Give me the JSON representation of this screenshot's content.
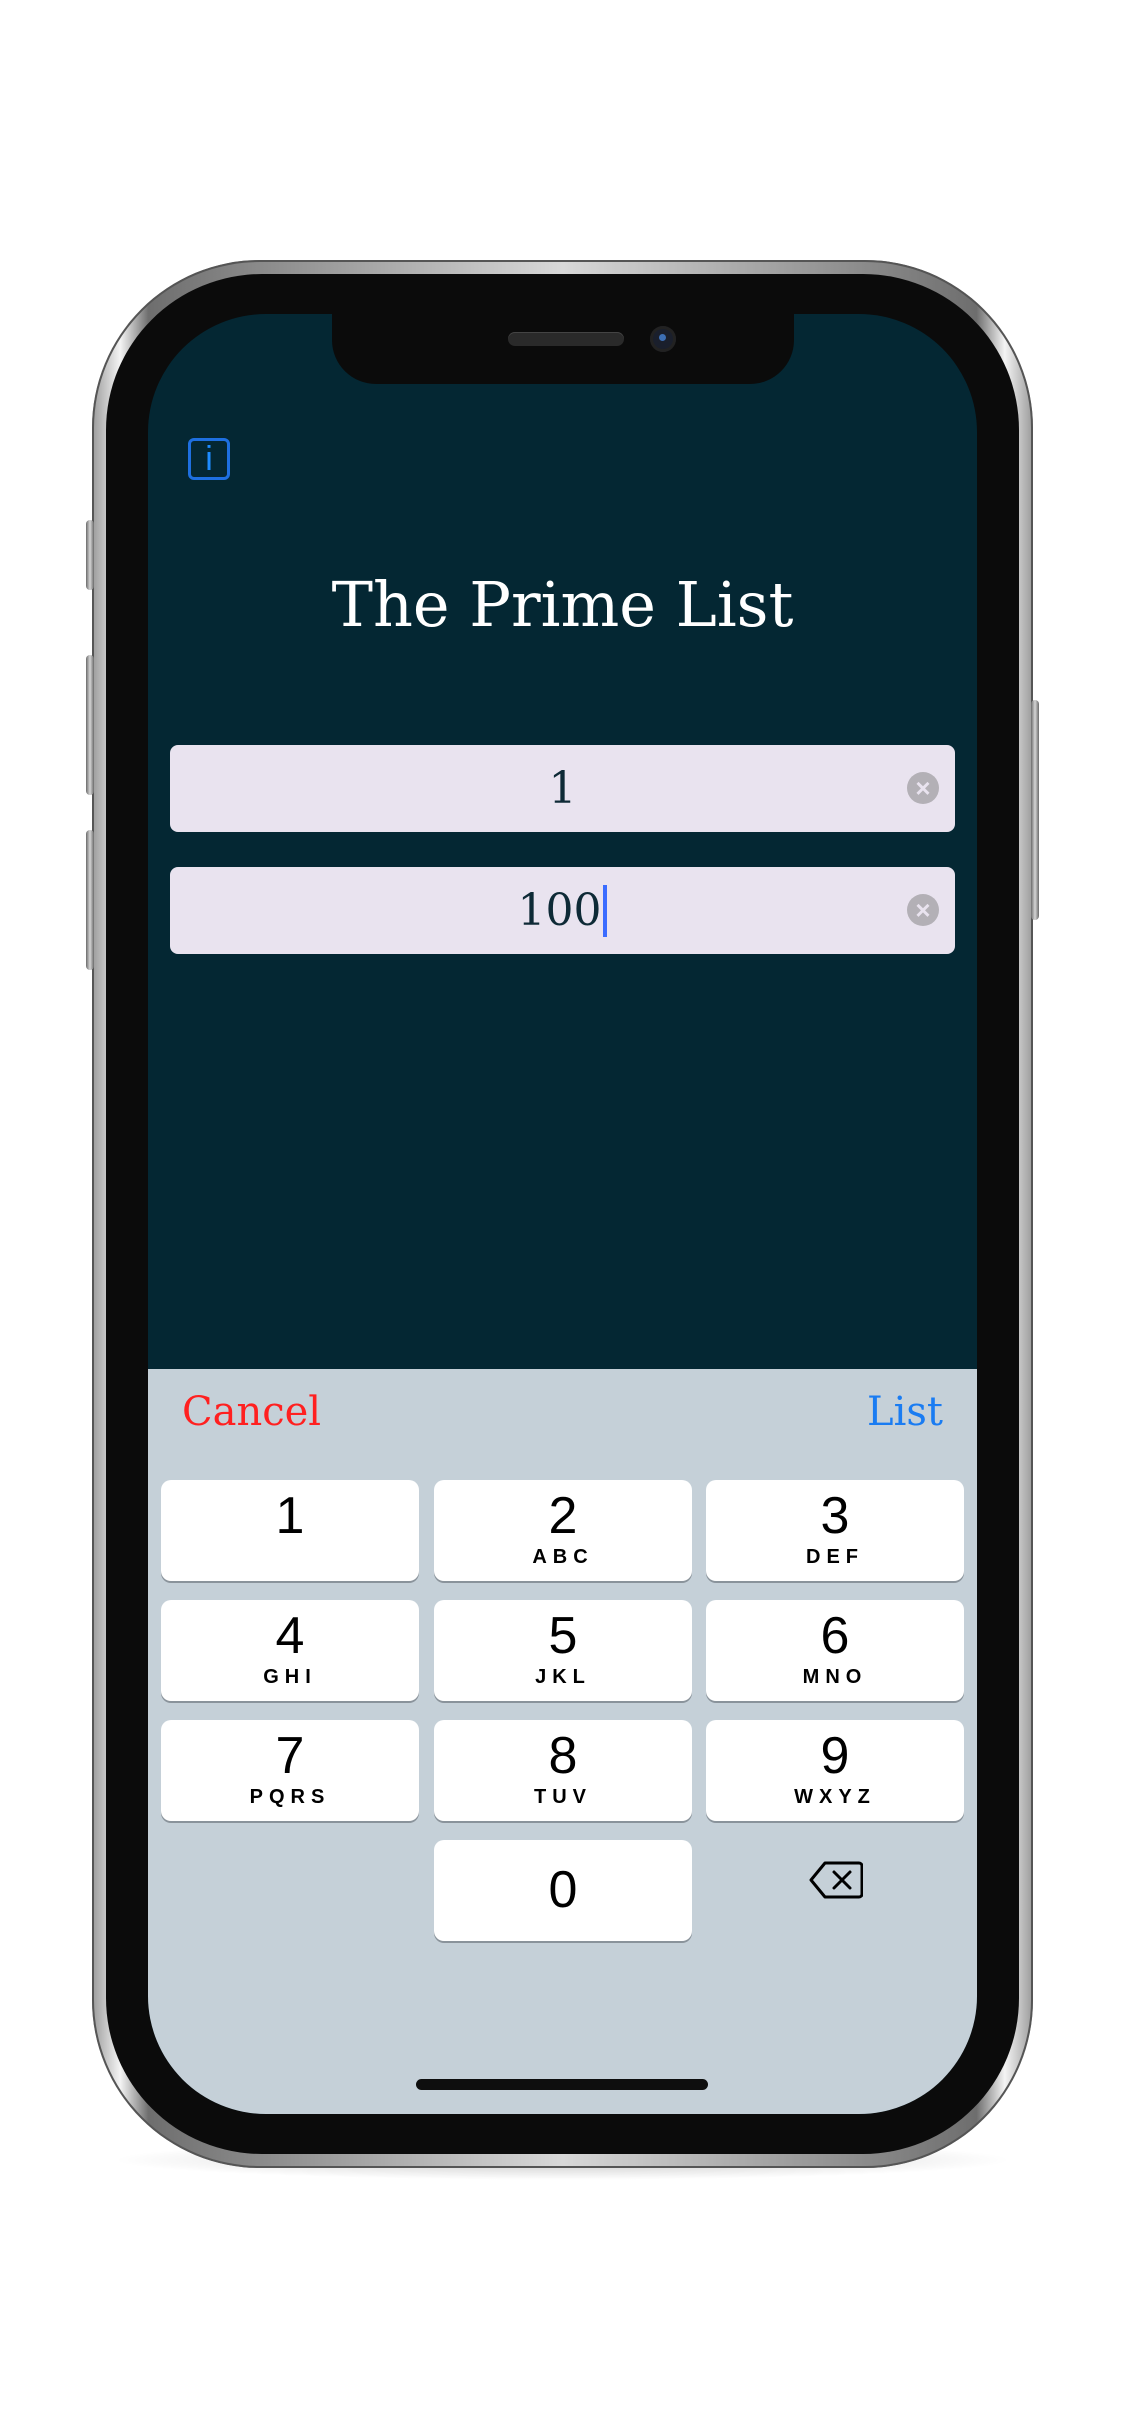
{
  "app": {
    "title": "The Prime List",
    "info_icon": "info-icon"
  },
  "inputs": [
    {
      "value": "1",
      "clear_icon": "clear-icon"
    },
    {
      "value": "100",
      "clear_icon": "clear-icon",
      "focused": true
    }
  ],
  "toolbar": {
    "cancel_label": "Cancel",
    "list_label": "List",
    "cancel_color": "#ff2020",
    "list_color": "#1a7cf2"
  },
  "keypad": {
    "keys": [
      {
        "digit": "1",
        "letters": ""
      },
      {
        "digit": "2",
        "letters": "ABC"
      },
      {
        "digit": "3",
        "letters": "DEF"
      },
      {
        "digit": "4",
        "letters": "GHI"
      },
      {
        "digit": "5",
        "letters": "JKL"
      },
      {
        "digit": "6",
        "letters": "MNO"
      },
      {
        "digit": "7",
        "letters": "PQRS"
      },
      {
        "digit": "8",
        "letters": "TUV"
      },
      {
        "digit": "9",
        "letters": "WXYZ"
      },
      {
        "digit": "0",
        "letters": ""
      }
    ],
    "backspace_icon": "backspace-icon"
  },
  "colors": {
    "background": "#042733",
    "input_background": "#e9e3ef",
    "keyboard_background": "#c5d0d8"
  }
}
